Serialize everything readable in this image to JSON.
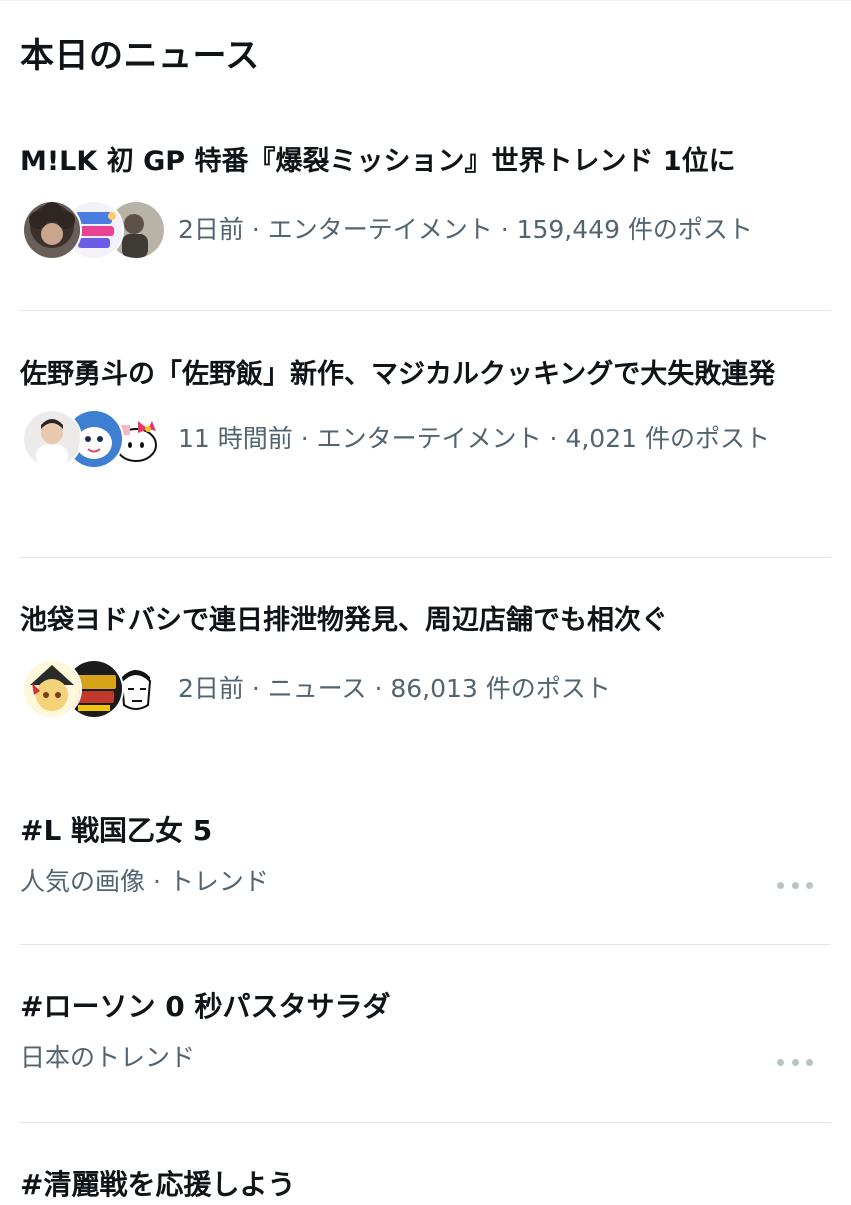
{
  "section": {
    "title": "本日のニュース"
  },
  "news": [
    {
      "headline": "M!LK 初 GP 特番『爆裂ミッション』世界トレンド 1位に",
      "meta": "2日前 · エンターテイメント · 159,449 件のポスト",
      "avatars": [
        "curly-hair-portrait-avatar",
        "variety-show-logo-avatar",
        "person-photo-avatar"
      ]
    },
    {
      "headline": "佐野勇斗の「佐野飯」新作、マジカルクッキングで大失敗連発",
      "meta": "11 時間前 · エンターテイメント · 4,021 件のポスト",
      "avatars": [
        "man-portrait-avatar",
        "cartoon-character-avatar",
        "hello-kitty-avatar"
      ]
    },
    {
      "headline": "池袋ヨドバシで連日排泄物発見、周辺店舗でも相次ぐ",
      "meta": "2日前 · ニュース · 86,013 件のポスト",
      "avatars": [
        "yukkuri-character-avatar",
        "news-logo-avatar",
        "manga-face-avatar"
      ]
    }
  ],
  "trends": [
    {
      "title": "#L 戦国乙女 5",
      "subtitle": "人気の画像 · トレンド"
    },
    {
      "title": "#ローソン 0 秒パスタサラダ",
      "subtitle": "日本のトレンド"
    },
    {
      "title": "#清麗戦を応援しよう",
      "subtitle": ""
    }
  ],
  "icons": {
    "more": "more-horizontal-icon"
  },
  "colors": {
    "text": "#0f1419",
    "secondary": "#536471",
    "divider": "#e1e6e9",
    "dots": "#b9c3ca"
  }
}
